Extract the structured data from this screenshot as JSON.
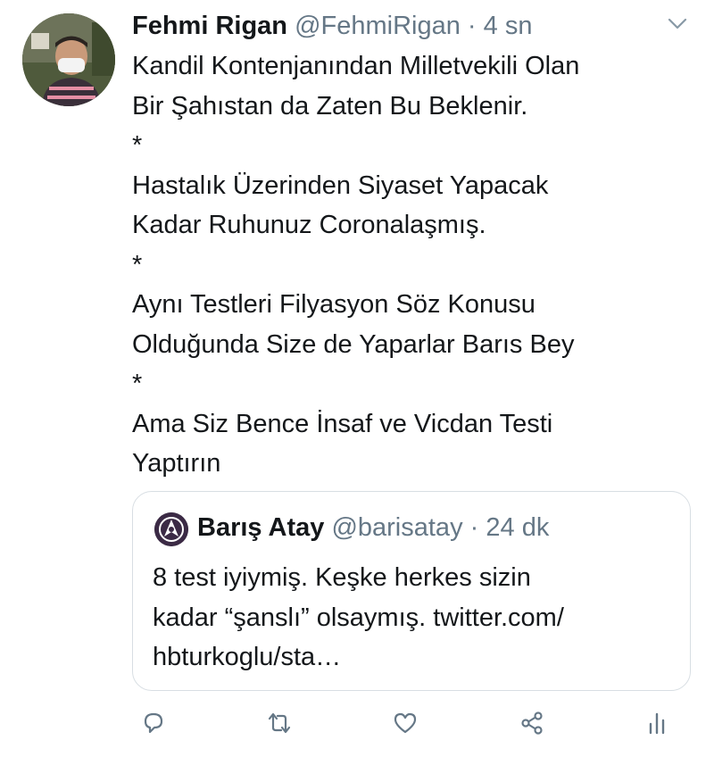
{
  "tweet": {
    "author_name": "Fehmi Rigan",
    "author_handle": "@FehmiRigan",
    "separator": "·",
    "time": "4 sn",
    "lines": [
      "Kandil Kontenjanından Milletvekili Olan",
      "Bir Şahıstan da Zaten Bu Beklenir.",
      "*",
      "Hastalık Üzerinden Siyaset Yapacak",
      "Kadar Ruhunuz Coronalaşmış.",
      "*",
      "Aynı Testleri Filyasyon Söz Konusu",
      "Olduğunda Size de Yaparlar Barıs Bey",
      "*",
      "Ama Siz Bence İnsaf ve Vicdan Testi",
      "Yaptırın"
    ]
  },
  "quote": {
    "author_name": "Barış Atay",
    "author_handle": "@barisatay",
    "separator": "·",
    "time": "24 dk",
    "lines": [
      "8 test iyiymiş. Keşke herkes sizin",
      "kadar “şanslı” olsaymış. twitter.com/",
      "hbturkoglu/sta…"
    ]
  },
  "actions": [
    "reply-icon",
    "retweet-icon",
    "like-icon",
    "share-icon",
    "analytics-icon"
  ],
  "colors": {
    "text": "#14171a",
    "muted": "#657786",
    "border": "#d8dee3"
  }
}
